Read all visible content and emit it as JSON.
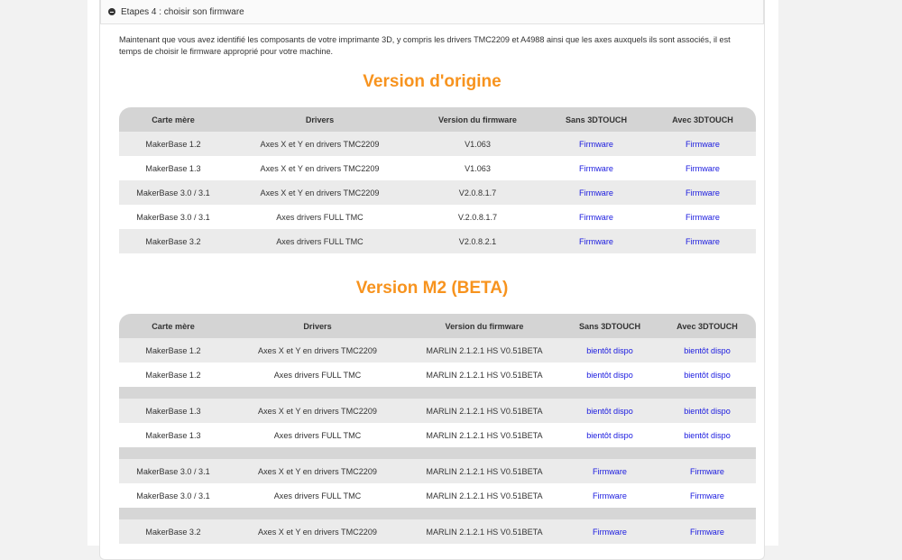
{
  "header": {
    "title": "Etapes 4 : choisir son firmware"
  },
  "intro": "Maintenant que vous avez identifié les composants de votre imprimante 3D, y compris les drivers TMC2209 et A4988 ainsi que les axes auxquels ils sont associés, il est temps de choisir le firmware approprié pour votre machine.",
  "colors": {
    "accent": "#f7931e",
    "link": "#1a1adf",
    "header_bg": "#d4d4d4"
  },
  "table1": {
    "title": "Version d'origine",
    "headers": [
      "Carte mère",
      "Drivers",
      "Version du firmware",
      "Sans 3DTOUCH",
      "Avec 3DTOUCH"
    ],
    "rows": [
      [
        "MakerBase 1.2",
        "Axes X et Y en drivers TMC2209",
        "V1.063",
        "Firmware",
        "Firmware"
      ],
      [
        "MakerBase 1.3",
        "Axes X et Y en drivers TMC2209",
        "V1.063",
        "Firmware",
        "Firmware"
      ],
      [
        "MakerBase 3.0 / 3.1",
        "Axes X et Y en drivers TMC2209",
        "V2.0.8.1.7",
        "Firmware",
        "Firmware"
      ],
      [
        "MakerBase 3.0 / 3.1",
        "Axes drivers FULL TMC",
        "V.2.0.8.1.7",
        "Firmware",
        "Firmware"
      ],
      [
        "MakerBase 3.2",
        "Axes drivers FULL TMC",
        "V2.0.8.2.1",
        "Firmware",
        "Firmware"
      ]
    ]
  },
  "table2": {
    "title": "Version M2 (BETA)",
    "headers": [
      "Carte mère",
      "Drivers",
      "Version du firmware",
      "Sans 3DTOUCH",
      "Avec 3DTOUCH"
    ],
    "rows": [
      [
        "MakerBase 1.2",
        "Axes X et Y en drivers TMC2209",
        "MARLIN 2.1.2.1 HS V0.51BETA",
        "bientôt dispo",
        "bientôt dispo"
      ],
      [
        "MakerBase 1.2",
        "Axes drivers FULL TMC",
        "MARLIN 2.1.2.1 HS V0.51BETA",
        "bientôt dispo",
        "bientôt dispo"
      ],
      null,
      [
        "MakerBase 1.3",
        "Axes X et Y en drivers TMC2209",
        "MARLIN 2.1.2.1 HS V0.51BETA",
        "bientôt dispo",
        "bientôt dispo"
      ],
      [
        "MakerBase 1.3",
        "Axes drivers FULL TMC",
        "MARLIN 2.1.2.1 HS V0.51BETA",
        "bientôt dispo",
        "bientôt dispo"
      ],
      null,
      [
        "MakerBase 3.0 / 3.1",
        "Axes X et Y en drivers TMC2209",
        "MARLIN 2.1.2.1 HS V0.51BETA",
        "Firmware",
        "Firmware"
      ],
      [
        "MakerBase 3.0 / 3.1",
        "Axes drivers FULL TMC",
        "MARLIN 2.1.2.1 HS V0.51BETA",
        "Firmware",
        "Firmware"
      ],
      null,
      [
        "MakerBase 3.2",
        "Axes X et Y en drivers TMC2209",
        "MARLIN 2.1.2.1 HS V0.51BETA",
        "Firmware",
        "Firmware"
      ]
    ]
  }
}
